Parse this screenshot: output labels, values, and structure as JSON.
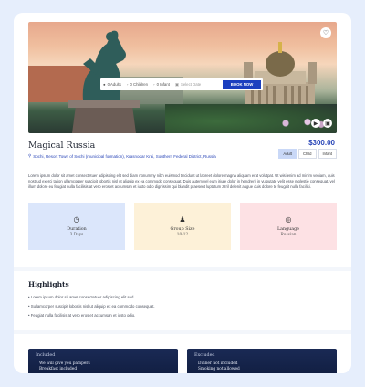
{
  "tour": {
    "title": "Magical Russia",
    "location": "Sochi, Resort Town of Sochi (municipal formation), Krasnodar Krai, Southern Federal District, Russia",
    "price": "$300.00",
    "pax_tabs": [
      "Adult",
      "Child",
      "Infant"
    ],
    "active_pax": "Adult",
    "description": "Lorem ipsum dolor sit amet consectetuer adipiscing elit sed diam nonummy nibh euismod tincidunt ut laoreet dolore magna aliquam erat volutpat. Ut wisi enim ad minim veniam, quis nostrud exerci tation ullamcorper suscipit lobortis nisl ut aliquip ex ea commodo consequat. Duis autem vel eum iriure dolor in hendrerit in vulputate velit esse molestie consequat, vel illum dolore eu feugiat nulla facilisis at vero eros et accumsan et iusto odio dignissim qui blandit praesent luptatum zzril delenit augue duis dolore te feugait nulla facilisi."
  },
  "booking": {
    "adults": "0 Adults",
    "children": "0 Children",
    "infant": "0 Infant",
    "date_placeholder": "Select Date",
    "book_label": "BOOK NOW"
  },
  "features": [
    {
      "icon": "clock-icon",
      "label": "Duration",
      "value": "3 Days"
    },
    {
      "icon": "group-icon",
      "label": "Group Size",
      "value": "10-12"
    },
    {
      "icon": "globe-icon",
      "label": "Language",
      "value": "Russian"
    }
  ],
  "highlights": {
    "title": "Highlights",
    "items": [
      "Lorem ipsum dolor sit amet consectetuer adipiscing elit sed",
      "Sullamcorper suscipit lobortis nisl ut aliquip ex ea commodo consequat.",
      "Feugiat nulla facilisis at vero eros et accumsan et iusto odio."
    ]
  },
  "included": {
    "heading": "Included",
    "items": [
      "We will give you pampers",
      "Breakfast included"
    ]
  },
  "excluded": {
    "heading": "Excluded",
    "items": [
      "Dinner not included",
      "Smoking not allowed"
    ]
  },
  "colors": {
    "accent": "#2b47b8",
    "book_button": "#1b3fbf",
    "duration_bg": "#dbe6fb",
    "group_bg": "#fdf1d8",
    "language_bg": "#fde1e4",
    "panel_bg": "#1a2a55"
  }
}
